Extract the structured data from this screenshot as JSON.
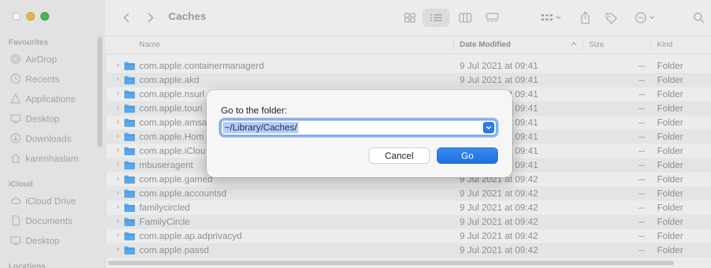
{
  "window": {
    "title": "Caches"
  },
  "sidebar": {
    "sections": [
      {
        "title": "Favourites",
        "items": [
          {
            "label": "AirDrop",
            "icon": "airdrop-icon"
          },
          {
            "label": "Recents",
            "icon": "clock-icon"
          },
          {
            "label": "Applications",
            "icon": "applications-icon"
          },
          {
            "label": "Desktop",
            "icon": "desktop-icon"
          },
          {
            "label": "Downloads",
            "icon": "downloads-icon"
          },
          {
            "label": "karenhaslam",
            "icon": "home-icon"
          }
        ]
      },
      {
        "title": "iCloud",
        "items": [
          {
            "label": "iCloud Drive",
            "icon": "cloud-icon"
          },
          {
            "label": "Documents",
            "icon": "document-icon"
          },
          {
            "label": "Desktop",
            "icon": "desktop-icon"
          }
        ]
      },
      {
        "title": "Locations",
        "items": []
      }
    ]
  },
  "columns": {
    "name": "Name",
    "date": "Date Modified",
    "size": "Size",
    "kind": "Kind"
  },
  "files": [
    {
      "name": "com.apple.containermanagerd",
      "date": "9 Jul 2021 at 09:41",
      "size": "--",
      "kind": "Folder"
    },
    {
      "name": "com.apple.akd",
      "date": "9 Jul 2021 at 09:41",
      "size": "--",
      "kind": "Folder"
    },
    {
      "name": "com.apple.nsurl",
      "date": "9 Jul 2021 at 09:41",
      "size": "--",
      "kind": "Folder"
    },
    {
      "name": "com.apple.touri",
      "date": "9 Jul 2021 at 09:41",
      "size": "--",
      "kind": "Folder"
    },
    {
      "name": "com.apple.amsa",
      "date": "9 Jul 2021 at 09:41",
      "size": "--",
      "kind": "Folder"
    },
    {
      "name": "com.apple.Hom",
      "date": "9 Jul 2021 at 09:41",
      "size": "--",
      "kind": "Folder"
    },
    {
      "name": "com.apple.iClou",
      "date": "9 Jul 2021 at 09:41",
      "size": "--",
      "kind": "Folder"
    },
    {
      "name": "mbuseragent",
      "date": "9 Jul 2021 at 09:41",
      "size": "--",
      "kind": "Folder"
    },
    {
      "name": "com.apple.gamed",
      "date": "9 Jul 2021 at 09:42",
      "size": "--",
      "kind": "Folder"
    },
    {
      "name": "com.apple.accountsd",
      "date": "9 Jul 2021 at 09:42",
      "size": "--",
      "kind": "Folder"
    },
    {
      "name": "familycircled",
      "date": "9 Jul 2021 at 09:42",
      "size": "--",
      "kind": "Folder"
    },
    {
      "name": "FamilyCircle",
      "date": "9 Jul 2021 at 09:42",
      "size": "--",
      "kind": "Folder"
    },
    {
      "name": "com.apple.ap.adprivacyd",
      "date": "9 Jul 2021 at 09:42",
      "size": "--",
      "kind": "Folder"
    },
    {
      "name": "com.apple.passd",
      "date": "9 Jul 2021 at 09:42",
      "size": "--",
      "kind": "Folder"
    }
  ],
  "dialog": {
    "label": "Go to the folder:",
    "path": "~/Library/Caches/",
    "cancel": "Cancel",
    "go": "Go"
  },
  "colors": {
    "accent": "#1f6fe0",
    "folder": "#5aa8e8",
    "selection": "#b4cdf4"
  }
}
